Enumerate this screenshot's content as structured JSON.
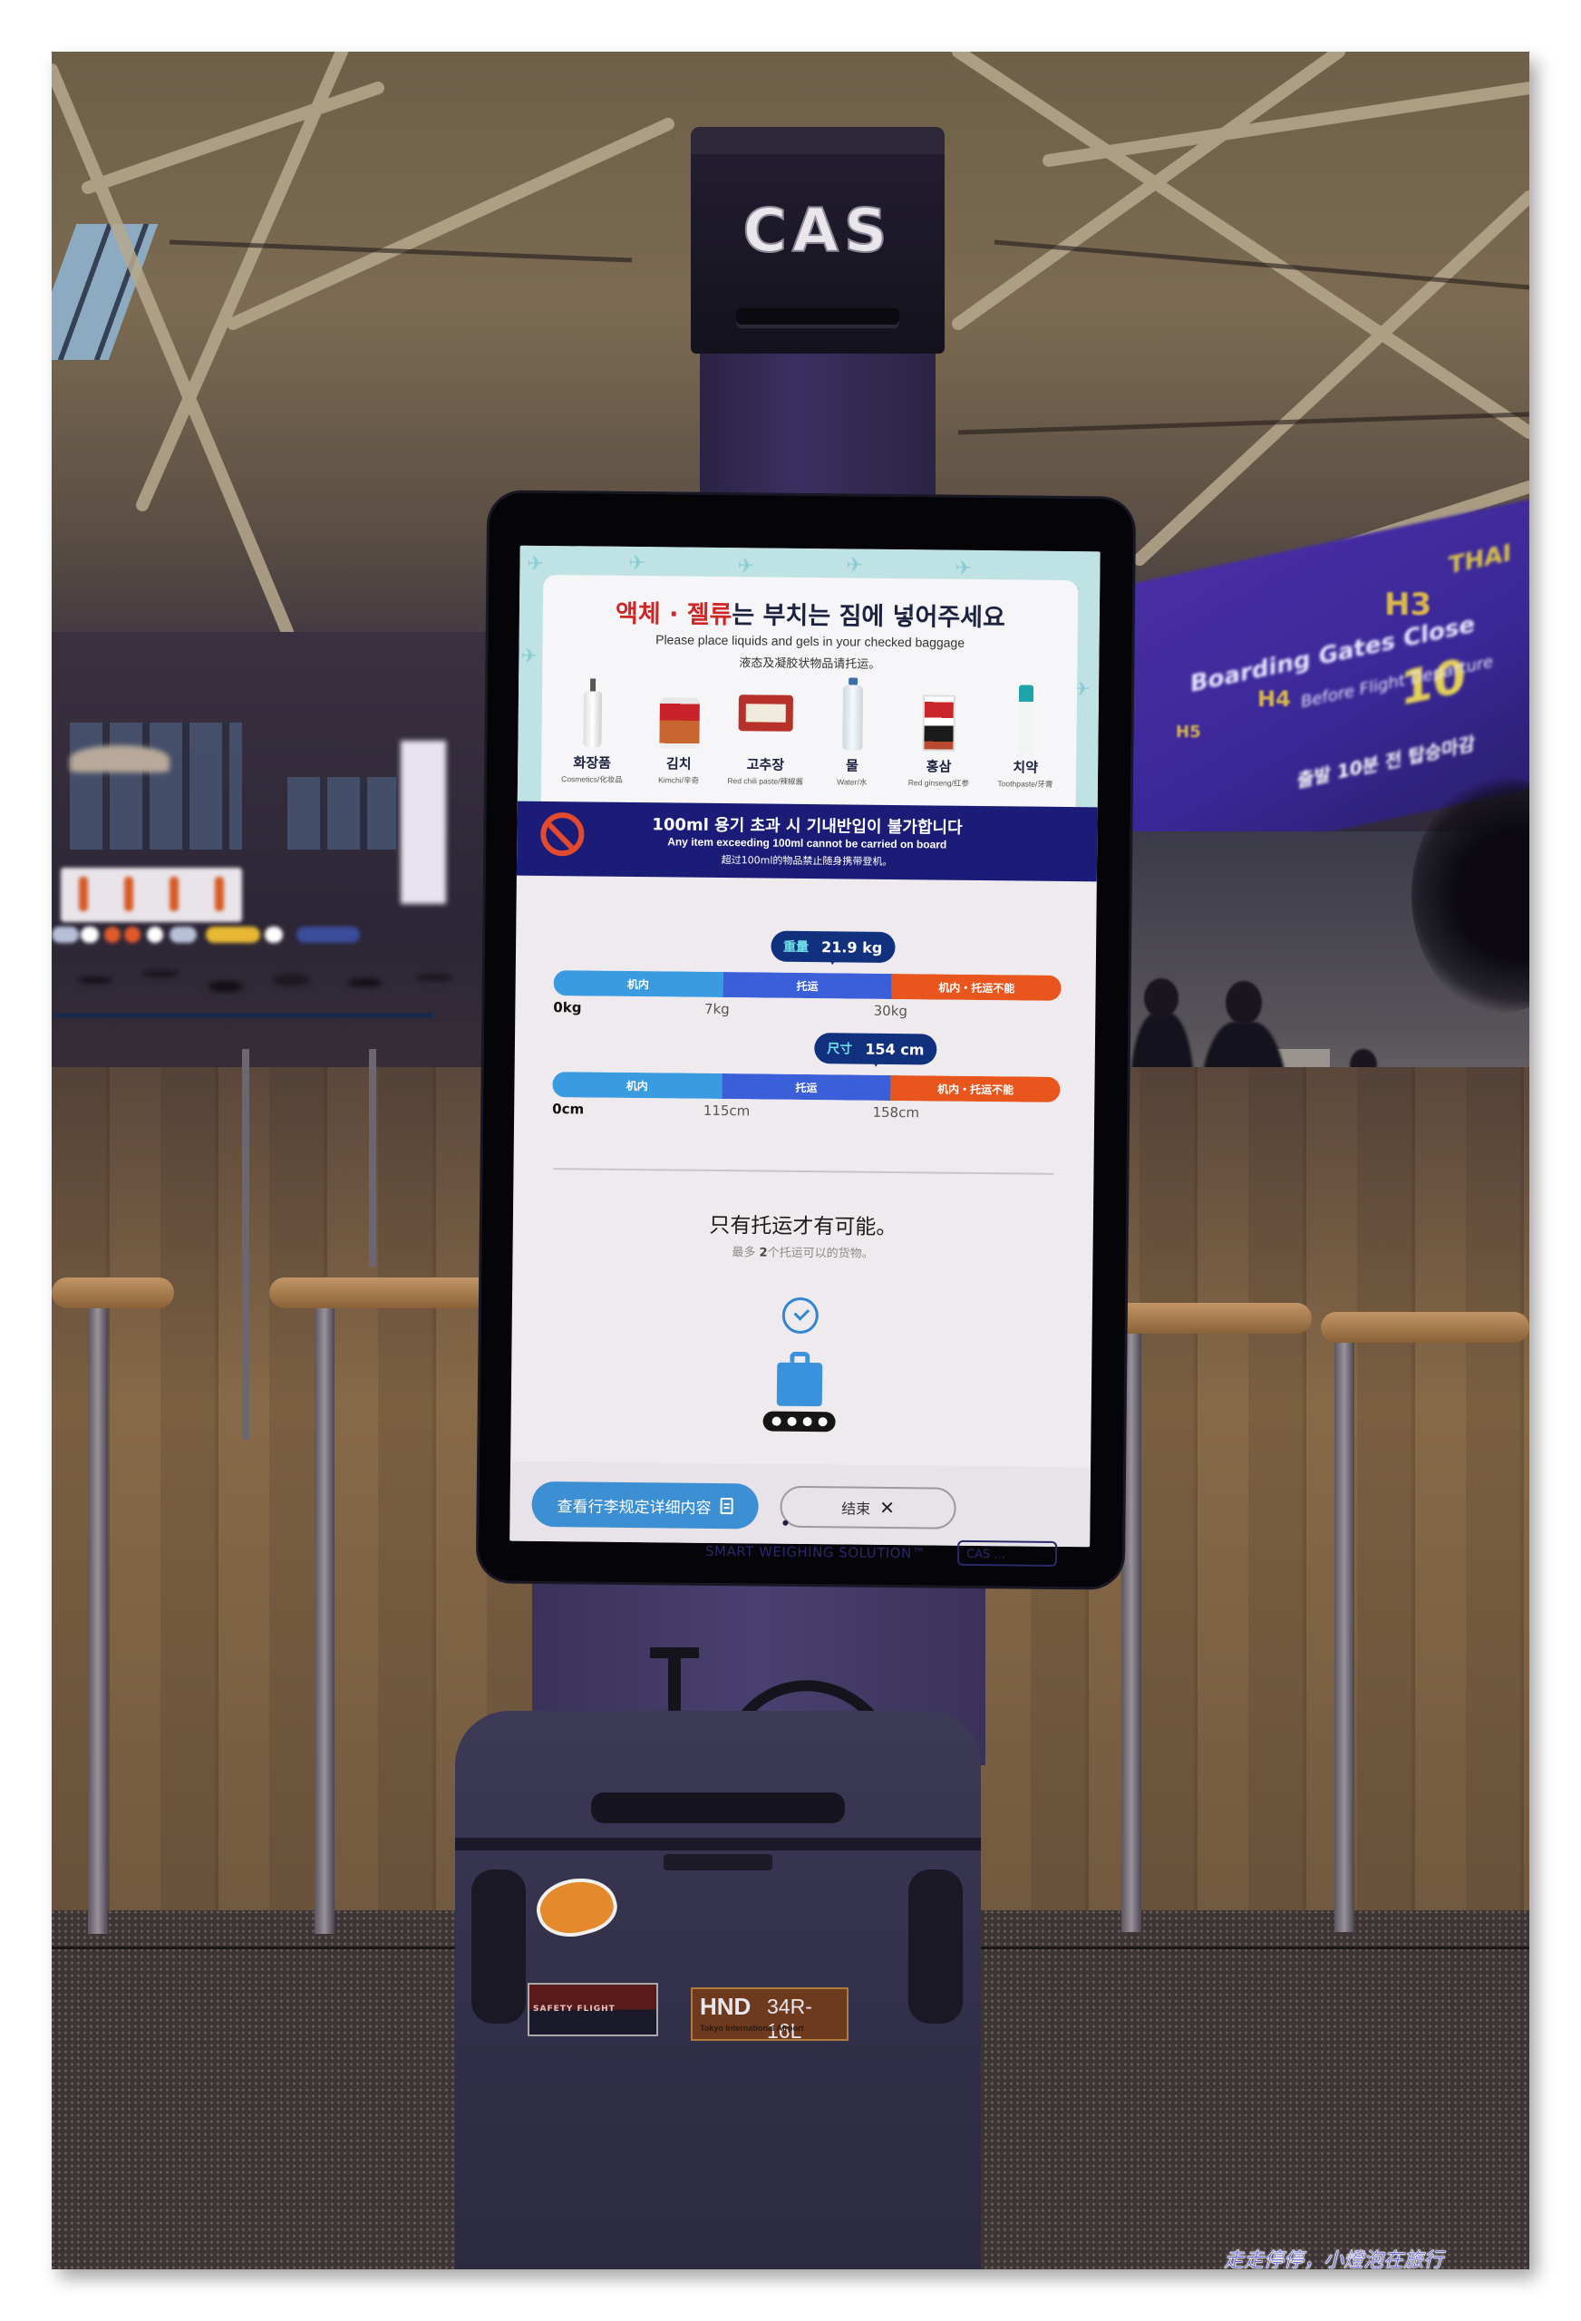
{
  "photo": {
    "kiosk_brand": "CAS",
    "bezel_brand": "SMART WEIGHING SOLUTION™",
    "bezel_badge": "CAS ...",
    "background_signage": {
      "airline": "THAI",
      "gates": [
        "H3",
        "H4",
        "H5"
      ],
      "headline": "Boarding Gates Close",
      "minutes": "10",
      "sub": "Before Flight Departure",
      "korean": "출발 10분 전 탑승마감"
    },
    "luggage_stickers": {
      "hnd_code": "HND",
      "runway": "34R-16L",
      "airport_name": "Tokyo International Airport",
      "flight_sticker": "SAFETY FLIGHT"
    },
    "watermark": "走走停停，小燈泡在旅行"
  },
  "screen": {
    "notice": {
      "title_red": "액체 · 젤류",
      "title_rest": "는 부치는 짐에 넣어주세요",
      "title_en": "Please place liquids and gels in your checked baggage",
      "title_zh": "液态及凝胶状物品请托运。",
      "items": [
        {
          "icon": "cosmetics-bottle-icon",
          "ko": "화장품",
          "sub": "Cosmetics/化妆品"
        },
        {
          "icon": "kimchi-jar-icon",
          "ko": "김치",
          "sub": "Kimchi/辛奇"
        },
        {
          "icon": "chili-paste-tub-icon",
          "ko": "고추장",
          "sub": "Red chili paste/辣椒酱"
        },
        {
          "icon": "water-bottle-icon",
          "ko": "물",
          "sub": "Water/水"
        },
        {
          "icon": "red-ginseng-box-icon",
          "ko": "홍삼",
          "sub": "Red ginseng/红参"
        },
        {
          "icon": "toothpaste-tube-icon",
          "ko": "치약",
          "sub": "Toothpaste/牙膏"
        }
      ]
    },
    "warning": {
      "icon": "prohibited-icon",
      "ko": "100ml 용기 초과 시 기내반입이 불가합니다",
      "en": "Any item exceeding 100ml cannot be carried on board",
      "zh": "超过100ml的物品禁止随身携带登机。"
    },
    "weight_gauge": {
      "label": "重量",
      "value_text": "21.9 kg",
      "value": 21.9,
      "unit": "kg",
      "segments": [
        {
          "label": "机内",
          "from": 0,
          "to": 7,
          "color": "#3a9be0"
        },
        {
          "label": "托运",
          "from": 7,
          "to": 30,
          "color": "#3a5fd8"
        },
        {
          "label": "机内・托运不能",
          "from": 30,
          "to": 45,
          "color": "#e8561e"
        }
      ],
      "ticks": [
        "0kg",
        "7kg",
        "30kg"
      ]
    },
    "size_gauge": {
      "label": "尺寸",
      "value_text": "154 cm",
      "value": 154,
      "unit": "cm",
      "segments": [
        {
          "label": "机内",
          "from": 0,
          "to": 115,
          "color": "#3a9be0"
        },
        {
          "label": "托运",
          "from": 115,
          "to": 158,
          "color": "#3a5fd8"
        },
        {
          "label": "机内・托运不能",
          "from": 158,
          "to": 200,
          "color": "#e8561e"
        }
      ],
      "ticks": [
        "0cm",
        "115cm",
        "158cm"
      ]
    },
    "result": {
      "title": "只有托运才有可能。",
      "sub_prefix": "最多 ",
      "sub_count": "2",
      "sub_suffix": "个托运可以的货物。"
    },
    "footer": {
      "details_button": "查看行李规定详细内容",
      "close_button": "结束"
    }
  }
}
